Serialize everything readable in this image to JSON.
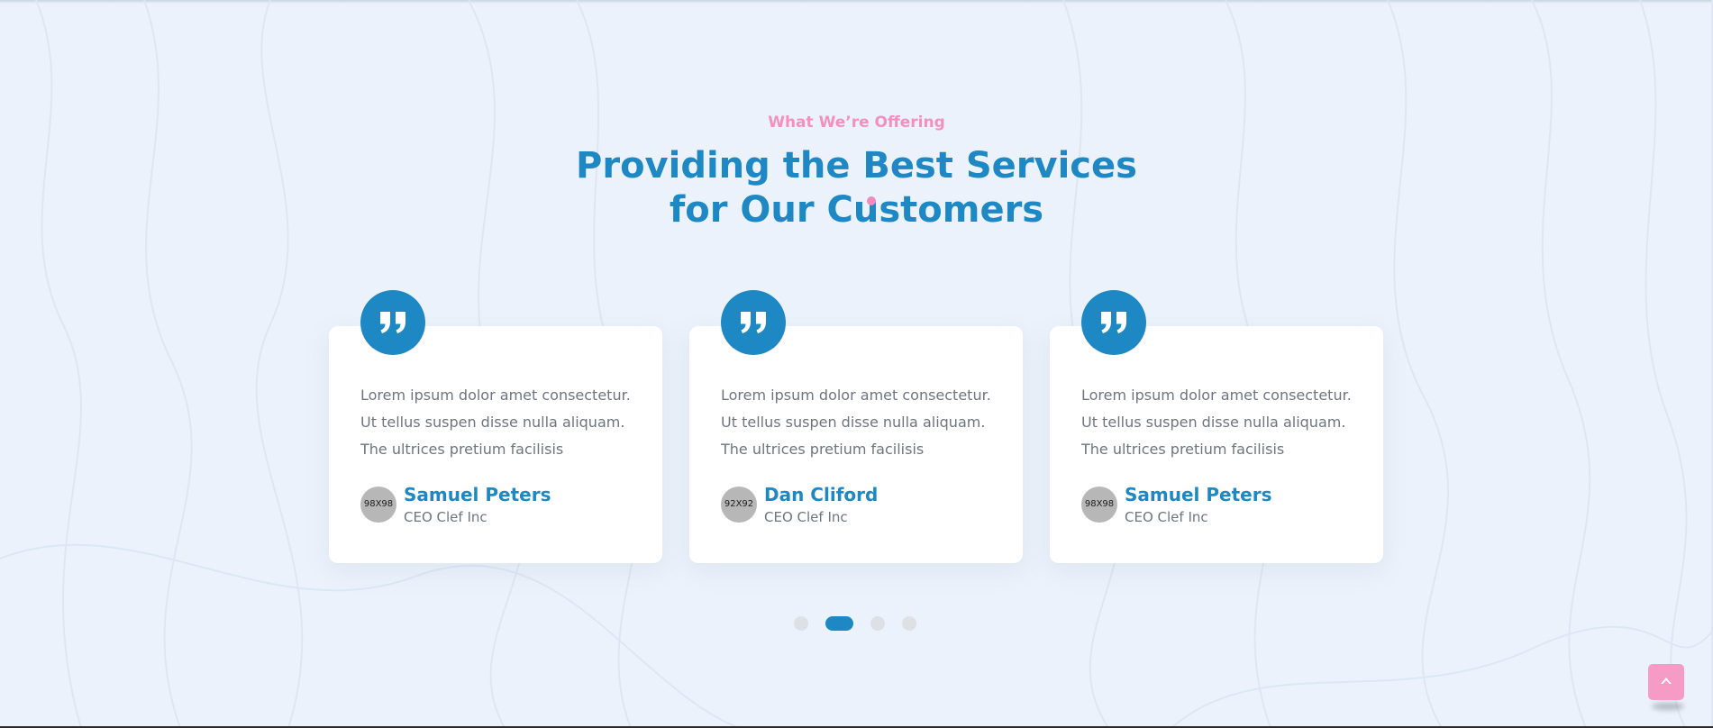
{
  "section": {
    "subtitle": "What We’re Offering",
    "heading_line1": "Providing the Best Services",
    "heading_line2": "for Our Customers"
  },
  "testimonials": [
    {
      "quote": "Lorem ipsum dolor amet consectetur. Ut tellus suspen disse nulla aliquam. The ultrices pretium facilisis",
      "avatar_placeholder": "98X98",
      "name": "Samuel Peters",
      "role": "CEO Clef Inc"
    },
    {
      "quote": "Lorem ipsum dolor amet consectetur. Ut tellus suspen disse nulla aliquam. The ultrices pretium facilisis",
      "avatar_placeholder": "92X92",
      "name": "Dan Cliford",
      "role": "CEO Clef Inc"
    },
    {
      "quote": "Lorem ipsum dolor amet consectetur. Ut tellus suspen disse nulla aliquam. The ultrices pretium facilisis",
      "avatar_placeholder": "98X98",
      "name": "Samuel Peters",
      "role": "CEO Clef Inc"
    }
  ],
  "pagination": {
    "count": 4,
    "active": 2
  },
  "icons": {
    "quote": "quote-icon",
    "scroll_top": "chevron-up-icon"
  },
  "colors": {
    "primary": "#1e88c4",
    "accent": "#f490bf",
    "background": "#ebf2fb",
    "card": "#ffffff",
    "body_text": "#6e7580"
  }
}
